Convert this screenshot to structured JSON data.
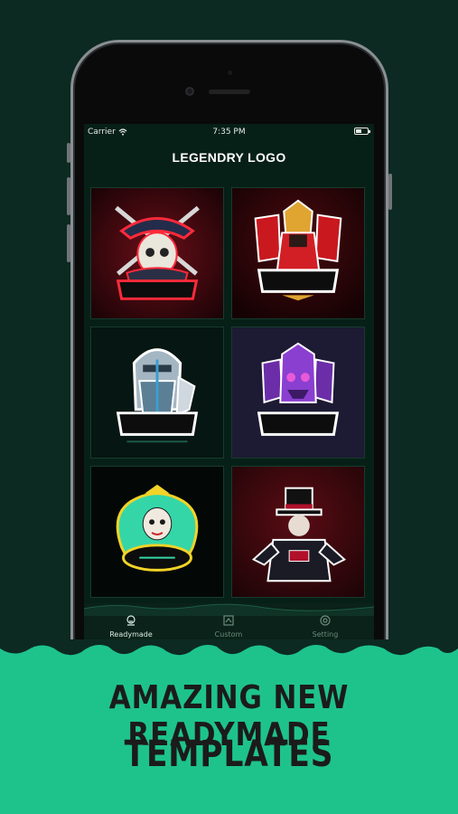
{
  "status_bar": {
    "carrier": "Carrier",
    "time": "7:35 PM"
  },
  "app": {
    "title": "LEGENDRY LOGO"
  },
  "templates": [
    {
      "name": "pirate-skull",
      "accent": "#c8102e"
    },
    {
      "name": "samurai-warrior",
      "accent": "#d61f26"
    },
    {
      "name": "knight-armor",
      "accent": "#7fa0b8"
    },
    {
      "name": "purple-demon",
      "accent": "#8a3fd0"
    },
    {
      "name": "medusa-queen",
      "accent": "#34d6a8"
    },
    {
      "name": "magician-hat",
      "accent": "#b0102a"
    }
  ],
  "tabbar": {
    "tabs": [
      {
        "label": "Readymade",
        "icon": "readymade-icon",
        "active": true
      },
      {
        "label": "Custom",
        "icon": "custom-icon",
        "active": false
      },
      {
        "label": "Setting",
        "icon": "setting-icon",
        "active": false
      }
    ]
  },
  "banner": {
    "line1": "AMAZING NEW READYMADE",
    "line2": "TEMPLATES"
  },
  "colors": {
    "background": "#0c2a21",
    "banner": "#1ec38c",
    "screen": "#072017"
  }
}
